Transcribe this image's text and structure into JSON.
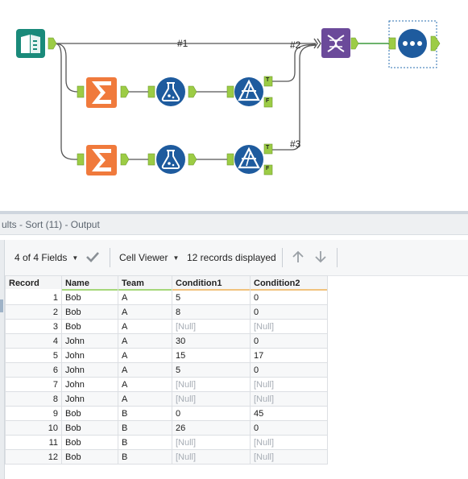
{
  "canvas": {
    "labels": [
      "#1",
      "#2",
      "#3"
    ],
    "anchors": [
      "T",
      "F",
      "T",
      "F"
    ]
  },
  "results": {
    "title": "ults - Sort (11) - Output",
    "fields_label": "4 of 4 Fields",
    "viewer_label": "Cell Viewer",
    "records_label": "12 records displayed",
    "columns": [
      "Record",
      "Name",
      "Team",
      "Condition1",
      "Condition2"
    ],
    "column_bar_colors": [
      "#ffffff",
      "#a6d77a",
      "#a6d77a",
      "#f1c27d",
      "#f1c27d"
    ],
    "rows": [
      [
        "1",
        "Bob",
        "A",
        "5",
        "0"
      ],
      [
        "2",
        "Bob",
        "A",
        "8",
        "0"
      ],
      [
        "3",
        "Bob",
        "A",
        "[Null]",
        "[Null]"
      ],
      [
        "4",
        "John",
        "A",
        "30",
        "0"
      ],
      [
        "5",
        "John",
        "A",
        "15",
        "17"
      ],
      [
        "6",
        "John",
        "A",
        "5",
        "0"
      ],
      [
        "7",
        "John",
        "A",
        "[Null]",
        "[Null]"
      ],
      [
        "8",
        "John",
        "A",
        "[Null]",
        "[Null]"
      ],
      [
        "9",
        "Bob",
        "B",
        "0",
        "45"
      ],
      [
        "10",
        "Bob",
        "B",
        "26",
        "0"
      ],
      [
        "11",
        "Bob",
        "B",
        "[Null]",
        "[Null]"
      ],
      [
        "12",
        "Bob",
        "B",
        "[Null]",
        "[Null]"
      ]
    ]
  },
  "colors": {
    "input_tool": "#1a8a7a",
    "summarize_tool": "#f07a3c",
    "formula_tool": "#1e5b9e",
    "filter_tool": "#1e5b9e",
    "union_tool": "#6b4a9a",
    "browse_tool": "#1e5b9e",
    "anchor": "#9ccc45",
    "connection": "#555555",
    "selected_connection": "#3c9a3c"
  }
}
